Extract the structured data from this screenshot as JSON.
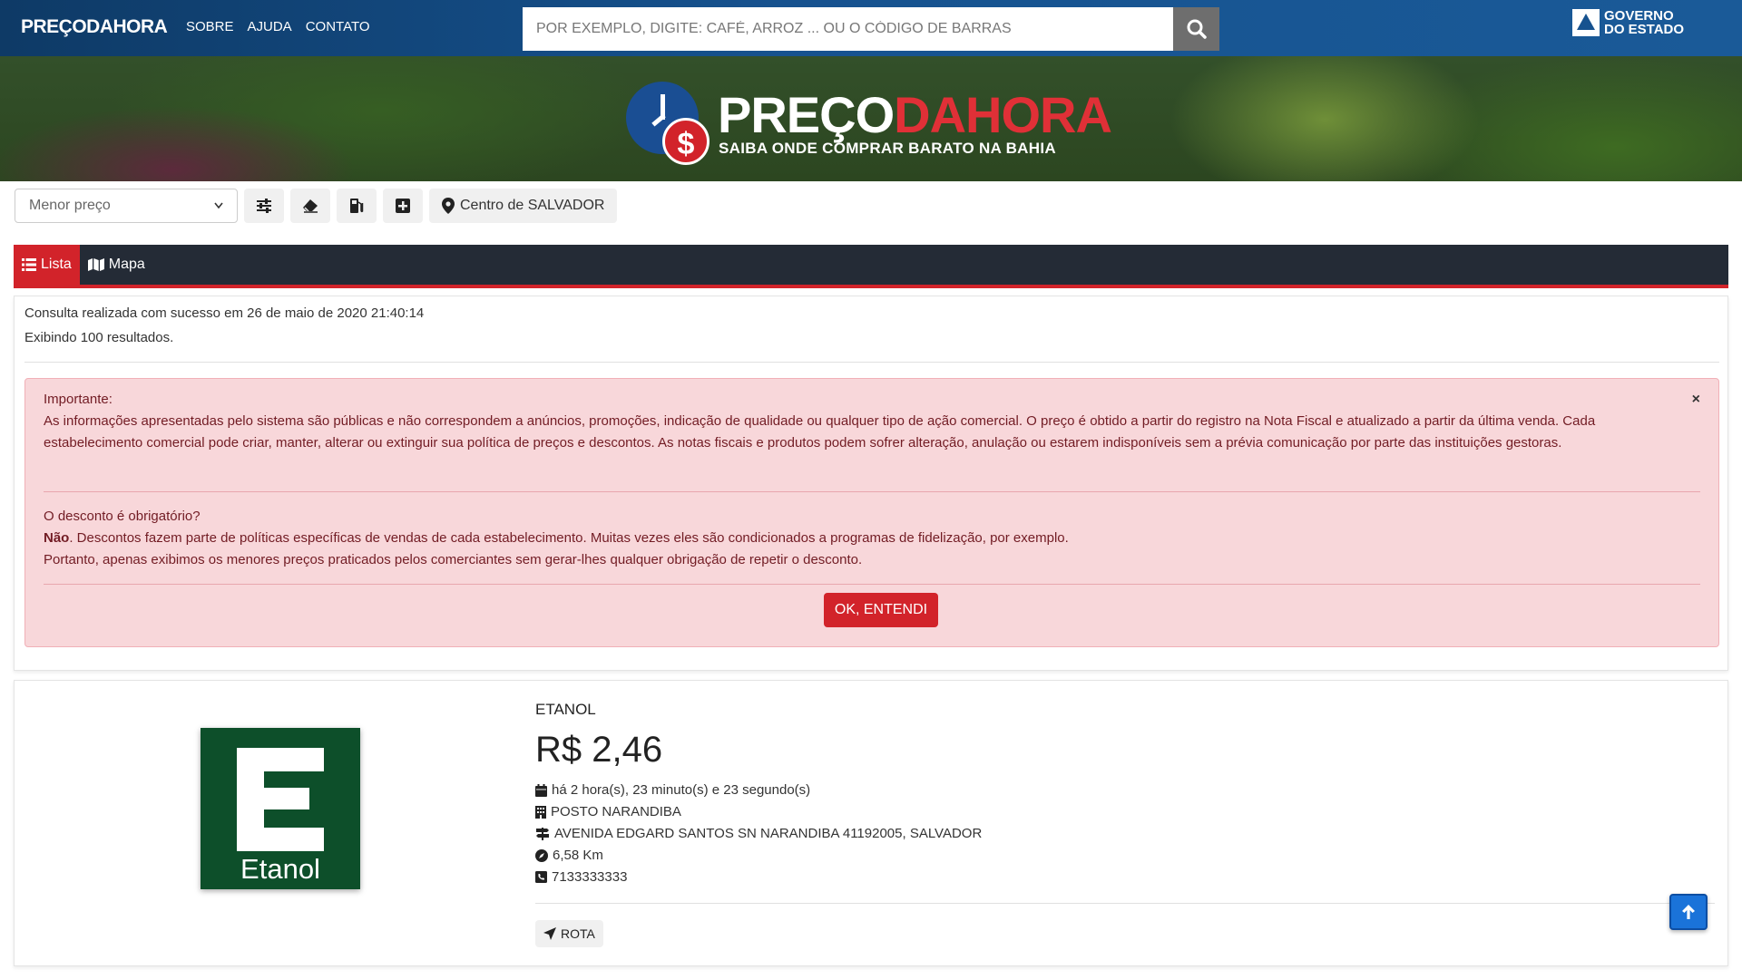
{
  "topbar": {
    "brand": "PREÇODAHORA",
    "nav": [
      "SOBRE",
      "AJUDA",
      "CONTATO"
    ],
    "search_placeholder": "POR EXEMPLO, DIGITE: CAFÉ, ARROZ ... OU O CÓDIGO DE BARRAS",
    "gov_line1": "GOVERNO",
    "gov_line2": "DO ESTADO"
  },
  "hero": {
    "title_white": "PREÇO",
    "title_red": "DAHORA",
    "subtitle": "SAIBA ONDE COMPRAR BARATO NA BAHIA"
  },
  "filters": {
    "sort_selected": "Menor preço",
    "location": "Centro de SALVADOR"
  },
  "tabs": [
    {
      "label": "Lista",
      "active": true
    },
    {
      "label": "Mapa",
      "active": false
    }
  ],
  "info": {
    "query_status": "Consulta realizada com sucesso em 26 de maio de 2020 21:40:14",
    "results_count": "Exibindo 100 resultados."
  },
  "alert": {
    "heading1": "Importante:",
    "body1": "As informações apresentadas pelo sistema são públicas e não correspondem a anúncios, promoções, indicação de qualidade ou qualquer tipo de ação comercial. O preço é obtido a partir do registro na Nota Fiscal e atualizado a partir da última venda. Cada estabelecimento comercial pode criar, manter, alterar ou extinguir sua política de preços e descontos. As notas fiscais e produtos podem sofrer alteração, anulação ou estarem indisponíveis sem a prévia comunicação por parte das instituições gestoras.",
    "heading2": "O desconto é obrigatório?",
    "answer_bold": "Não",
    "body2": ". Descontos fazem parte de políticas específicas de vendas de cada estabelecimento. Muitas vezes eles são condicionados a programas de fidelização, por exemplo.",
    "body3": "Portanto, apenas exibimos os menores preços praticados pelos comerciantes sem gerar-lhes qualquer obrigação de repetir o desconto.",
    "close": "×",
    "ok_button": "OK, ENTENDI"
  },
  "result": {
    "image_label": "Etanol",
    "name": "ETANOL",
    "price": "R$ 2,46",
    "time_ago": "há 2 hora(s), 23 minuto(s) e 23 segundo(s)",
    "store": "POSTO NARANDIBA",
    "address": "AVENIDA EDGARD SANTOS SN NARANDIBA 41192005, SALVADOR",
    "distance": "6,58 Km",
    "phone": "7133333333",
    "route_button": "ROTA"
  },
  "colors": {
    "brand_blue": "#16528f",
    "brand_red": "#d2232a",
    "tabs_dark": "#242b36",
    "alert_bg": "#f8d7da",
    "etanol_green": "#0d4f2a"
  },
  "icons": [
    "search-icon",
    "sliders-icon",
    "eraser-icon",
    "fuel-pump-icon",
    "plus-square-icon",
    "map-marker-icon",
    "list-icon",
    "map-icon",
    "calendar-icon",
    "building-icon",
    "signpost-icon",
    "compass-icon",
    "phone-icon",
    "location-arrow-icon",
    "arrow-up-icon"
  ]
}
